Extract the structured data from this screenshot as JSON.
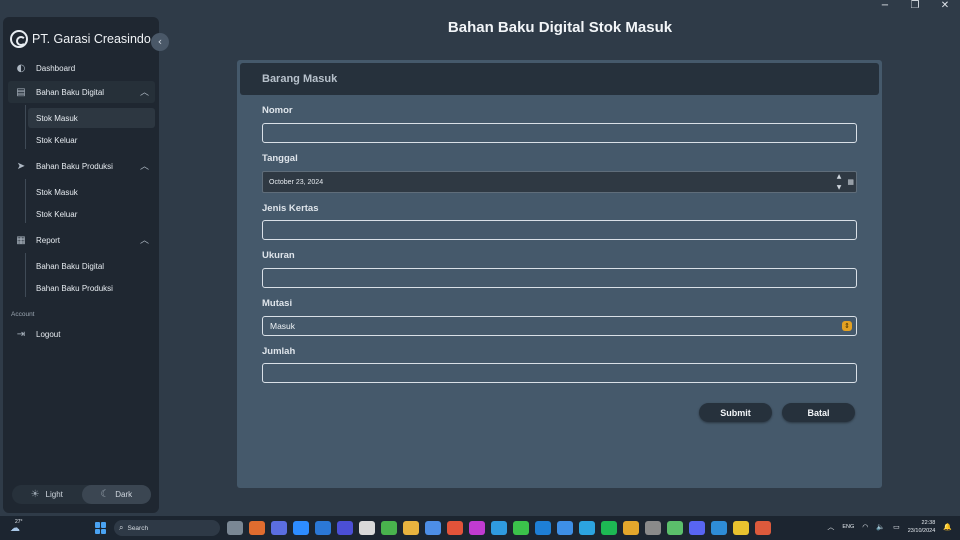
{
  "window": {
    "minimize": "−",
    "restore": "❐",
    "close": "✕"
  },
  "sidebar": {
    "brand": "PT. Garasi Creasindo",
    "collapse_icon": "‹",
    "items": [
      {
        "label": "Dashboard",
        "icon": "◐"
      },
      {
        "label": "Bahan Baku Digital",
        "icon": "▤",
        "chevron": "︿"
      },
      {
        "label": "Bahan Baku Produksi",
        "icon": "➤",
        "chevron": "︿"
      },
      {
        "label": "Report",
        "icon": "▦",
        "chevron": "︿"
      }
    ],
    "sub_digital": [
      "Stok Masuk",
      "Stok Keluar"
    ],
    "sub_produksi": [
      "Stok Masuk",
      "Stok Keluar"
    ],
    "sub_report": [
      "Bahan Baku Digital",
      "Bahan Baku Produksi"
    ],
    "section_account": "Account",
    "logout": {
      "label": "Logout",
      "icon": "⇥"
    },
    "theme": {
      "light": "Light",
      "dark": "Dark",
      "light_icon": "☀",
      "dark_icon": "☾"
    }
  },
  "page": {
    "title": "Bahan Baku Digital Stok Masuk"
  },
  "form": {
    "header": "Barang Masuk",
    "fields": {
      "nomor": {
        "label": "Nomor",
        "value": ""
      },
      "tanggal": {
        "label": "Tanggal",
        "value": "October 23, 2024"
      },
      "jenis": {
        "label": "Jenis Kertas",
        "value": ""
      },
      "ukuran": {
        "label": "Ukuran",
        "value": ""
      },
      "mutasi": {
        "label": "Mutasi",
        "value": "Masuk"
      },
      "jumlah": {
        "label": "Jumlah",
        "value": ""
      }
    },
    "submit": "Submit",
    "cancel": "Batal"
  },
  "taskbar": {
    "temperature": "27°",
    "search_placeholder": "Search",
    "language": "ENG",
    "time": "22:38",
    "date": "23/10/2024",
    "app_colors": [
      "#7a8794",
      "#e06c2f",
      "#5b6ee1",
      "#2d8cff",
      "#2b78d6",
      "#4b4fd6",
      "#d9d9d9",
      "#49b34d",
      "#e8b33f",
      "#4d8ee6",
      "#e2533a",
      "#c03bd1",
      "#2f9be0",
      "#3bc24b",
      "#1e7fd6",
      "#3e8fe6",
      "#2ca4e0",
      "#1db954",
      "#e4a72c",
      "#8a8a8a",
      "#5bbf6b",
      "#5865f2",
      "#2e8cd6",
      "#e8c22f",
      "#dc5a3c"
    ]
  }
}
